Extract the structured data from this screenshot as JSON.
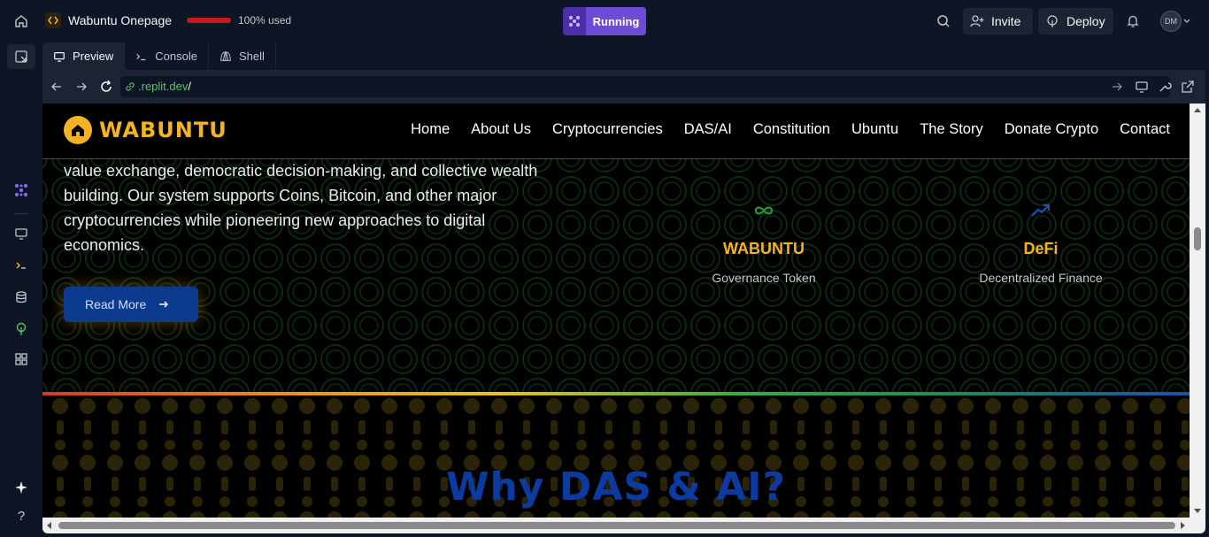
{
  "topbar": {
    "repl_name": "Wabuntu Onepage",
    "usage_text": "100% used",
    "usage_fraction": 1.0,
    "run_label": "Running",
    "invite_label": "Invite",
    "deploy_label": "Deploy",
    "avatar_initials": "DM"
  },
  "tabs": [
    {
      "label": "Preview",
      "icon": "monitor-icon"
    },
    {
      "label": "Console",
      "icon": "terminal-icon"
    },
    {
      "label": "Shell",
      "icon": "shell-icon"
    }
  ],
  "url": {
    "host": ".replit.dev",
    "path": "/"
  },
  "site": {
    "logo": "WABUNTU",
    "nav": [
      "Home",
      "About Us",
      "Cryptocurrencies",
      "DAS/AI",
      "Constitution",
      "Ubuntu",
      "The Story",
      "Donate Crypto",
      "Contact"
    ],
    "hero_lines": [
      "value exchange, democratic decision-making, and collective wealth",
      "building. Our system supports Coins, Bitcoin, and other major",
      "cryptocurrencies while pioneering new approaches to digital",
      "economics."
    ],
    "read_more": "Read More",
    "cards": [
      {
        "title": "WABUNTU",
        "subtitle": "Governance Token",
        "icon": "infinity-icon"
      },
      {
        "title": "DeFi",
        "subtitle": "Decentralized Finance",
        "icon": "trending-up-icon"
      }
    ],
    "section_heading": "Why DAS & AI?"
  },
  "colors": {
    "accent_gold": "#f5b324",
    "run_purple": "#6d4bd6",
    "url_green": "#58c560",
    "button_blue": "#0b3a8f",
    "heading_blue": "#0b3aa0"
  }
}
